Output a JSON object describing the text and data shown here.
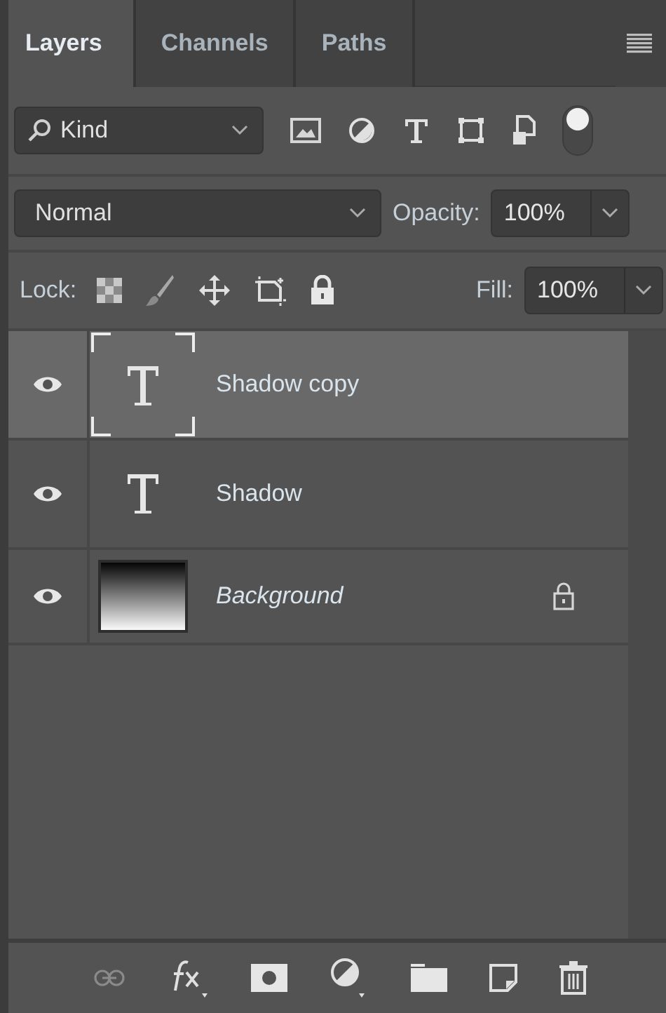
{
  "tabs": [
    {
      "label": "Layers",
      "selected": true
    },
    {
      "label": "Channels",
      "selected": false
    },
    {
      "label": "Paths",
      "selected": false
    }
  ],
  "filter": {
    "value": "Kind",
    "on": true
  },
  "blend_mode": {
    "value": "Normal"
  },
  "opacity": {
    "label": "Opacity:",
    "value": "100%"
  },
  "lock": {
    "label": "Lock:"
  },
  "fill": {
    "label": "Fill:",
    "value": "100%"
  },
  "layers": [
    {
      "name": "Shadow copy",
      "kind": "text",
      "selected": true,
      "visible": true,
      "locked": false
    },
    {
      "name": "Shadow",
      "kind": "text",
      "selected": false,
      "visible": true,
      "locked": false
    },
    {
      "name": "Background",
      "kind": "background",
      "selected": false,
      "visible": true,
      "locked": true
    }
  ]
}
